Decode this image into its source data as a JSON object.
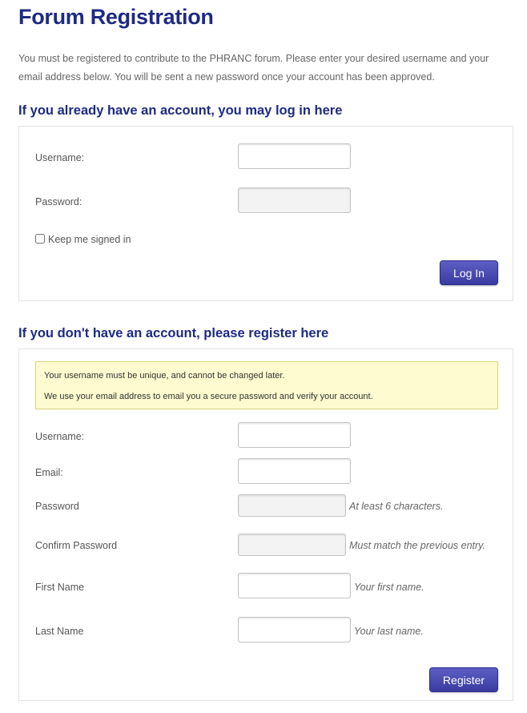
{
  "page": {
    "title": "Forum Registration",
    "intro": "You must be registered to contribute to the PHRANC forum. Please enter your desired username and your email address below. You will be sent a new password once your account has been approved."
  },
  "login": {
    "heading": "If you already have an account, you may log in here",
    "username_label": "Username:",
    "username_value": "",
    "password_label": "Password:",
    "password_value": "",
    "remember_label": "Keep me signed in",
    "remember_checked": false,
    "submit_label": "Log In"
  },
  "register": {
    "heading": "If you don't have an account, please register here",
    "notice_line1": "Your username must be unique, and cannot be changed later.",
    "notice_line2": "We use your email address to email you a secure password and verify your account.",
    "username_label": "Username:",
    "email_label": "Email:",
    "password_label": "Password",
    "password_hint": "At least 6 characters.",
    "confirm_label": "Confirm Password",
    "confirm_hint": "Must match the previous entry.",
    "first_name_label": "First Name",
    "first_name_hint": "Your first name.",
    "last_name_label": "Last Name",
    "last_name_hint": "Your last name.",
    "submit_label": "Register"
  },
  "colors": {
    "heading": "#1e2a84",
    "button": "#4a4cb3",
    "notice_bg": "#fdfbcf",
    "notice_border": "#d9d477"
  }
}
